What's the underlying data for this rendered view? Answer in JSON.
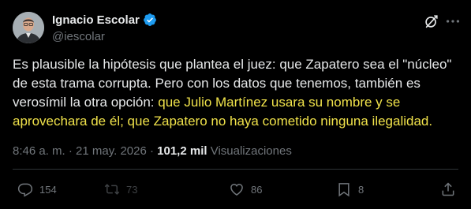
{
  "author": {
    "name": "Ignacio Escolar",
    "handle": "@iescolar"
  },
  "tweet": {
    "text_main": "Es plausible la hipótesis que plantea el juez: que Zapatero sea el \"núcleo\" de esta trama corrupta. Pero con los datos que tenemos, también es verosímil la otra opción: ",
    "text_highlight": "que Julio Martínez usara su nombre y se aprovechara de él; que Zapatero no haya cometido ninguna ilegalidad."
  },
  "meta": {
    "time": "8:46 a. m. · 21 may. 2026 · ",
    "views_count": "101,2 mil",
    "views_label": " Visualizaciones"
  },
  "actions": {
    "replies": "154",
    "reposts": "73",
    "likes": "86",
    "bookmarks": "8"
  },
  "colors": {
    "background": "#000000",
    "text": "#e7e9ea",
    "muted": "#71767b",
    "highlight": "#f0e24a",
    "verified": "#1d9bf0"
  },
  "icons": [
    "verified-badge-icon",
    "grok-icon",
    "more-icon",
    "reply-icon",
    "repost-icon",
    "like-icon",
    "bookmark-icon",
    "share-icon"
  ]
}
